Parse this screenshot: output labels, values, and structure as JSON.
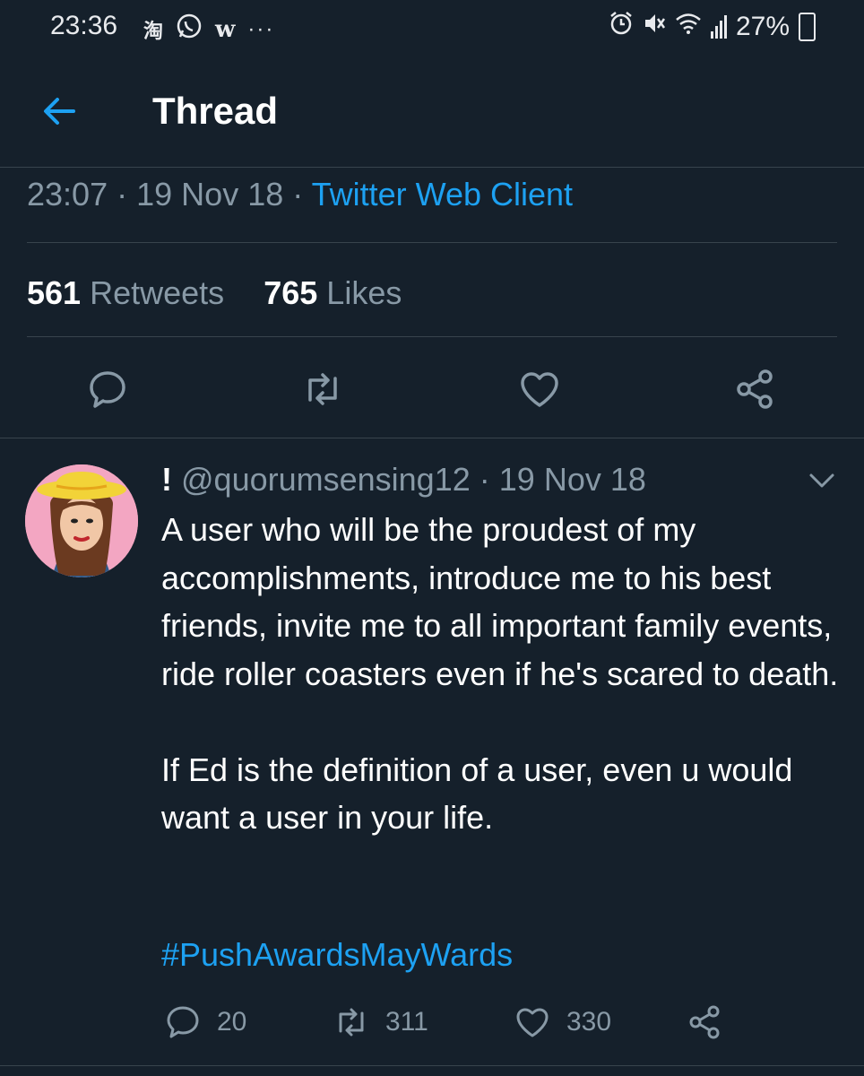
{
  "status_bar": {
    "time": "23:36",
    "app_icons": [
      "taobao-icon",
      "whatsapp-icon",
      "w-app-icon",
      "more-dots-icon"
    ],
    "battery": "27%",
    "right_icons": [
      "alarm-icon",
      "mute-icon",
      "wifi-icon",
      "signal-icon",
      "battery-icon"
    ]
  },
  "header": {
    "title": "Thread"
  },
  "tweet_meta": {
    "time": "23:07",
    "date": "19 Nov 18",
    "client": "Twitter Web Client",
    "separator": "·"
  },
  "stats": {
    "retweets_count": "561",
    "retweets_label": "Retweets",
    "likes_count": "765",
    "likes_label": "Likes"
  },
  "actions": [
    "reply-icon",
    "retweet-icon",
    "like-icon",
    "share-icon"
  ],
  "reply": {
    "name": "!",
    "handle": "@quorumsensing12",
    "date": "19 Nov 18",
    "text": "A user who will be the proudest of my accomplishments, introduce me to his best friends, invite me to all important family events, ride roller coasters even if he's scared to death.\n\nIf Ed is the definition of a user, even u would want a user in your life.",
    "hashtag": "#PushAwardsMayWards",
    "replies": "20",
    "retweets": "311",
    "likes": "330"
  },
  "colors": {
    "background": "#15202b",
    "accent": "#1da1f2",
    "muted": "#8899a6",
    "divider": "#38444d"
  }
}
